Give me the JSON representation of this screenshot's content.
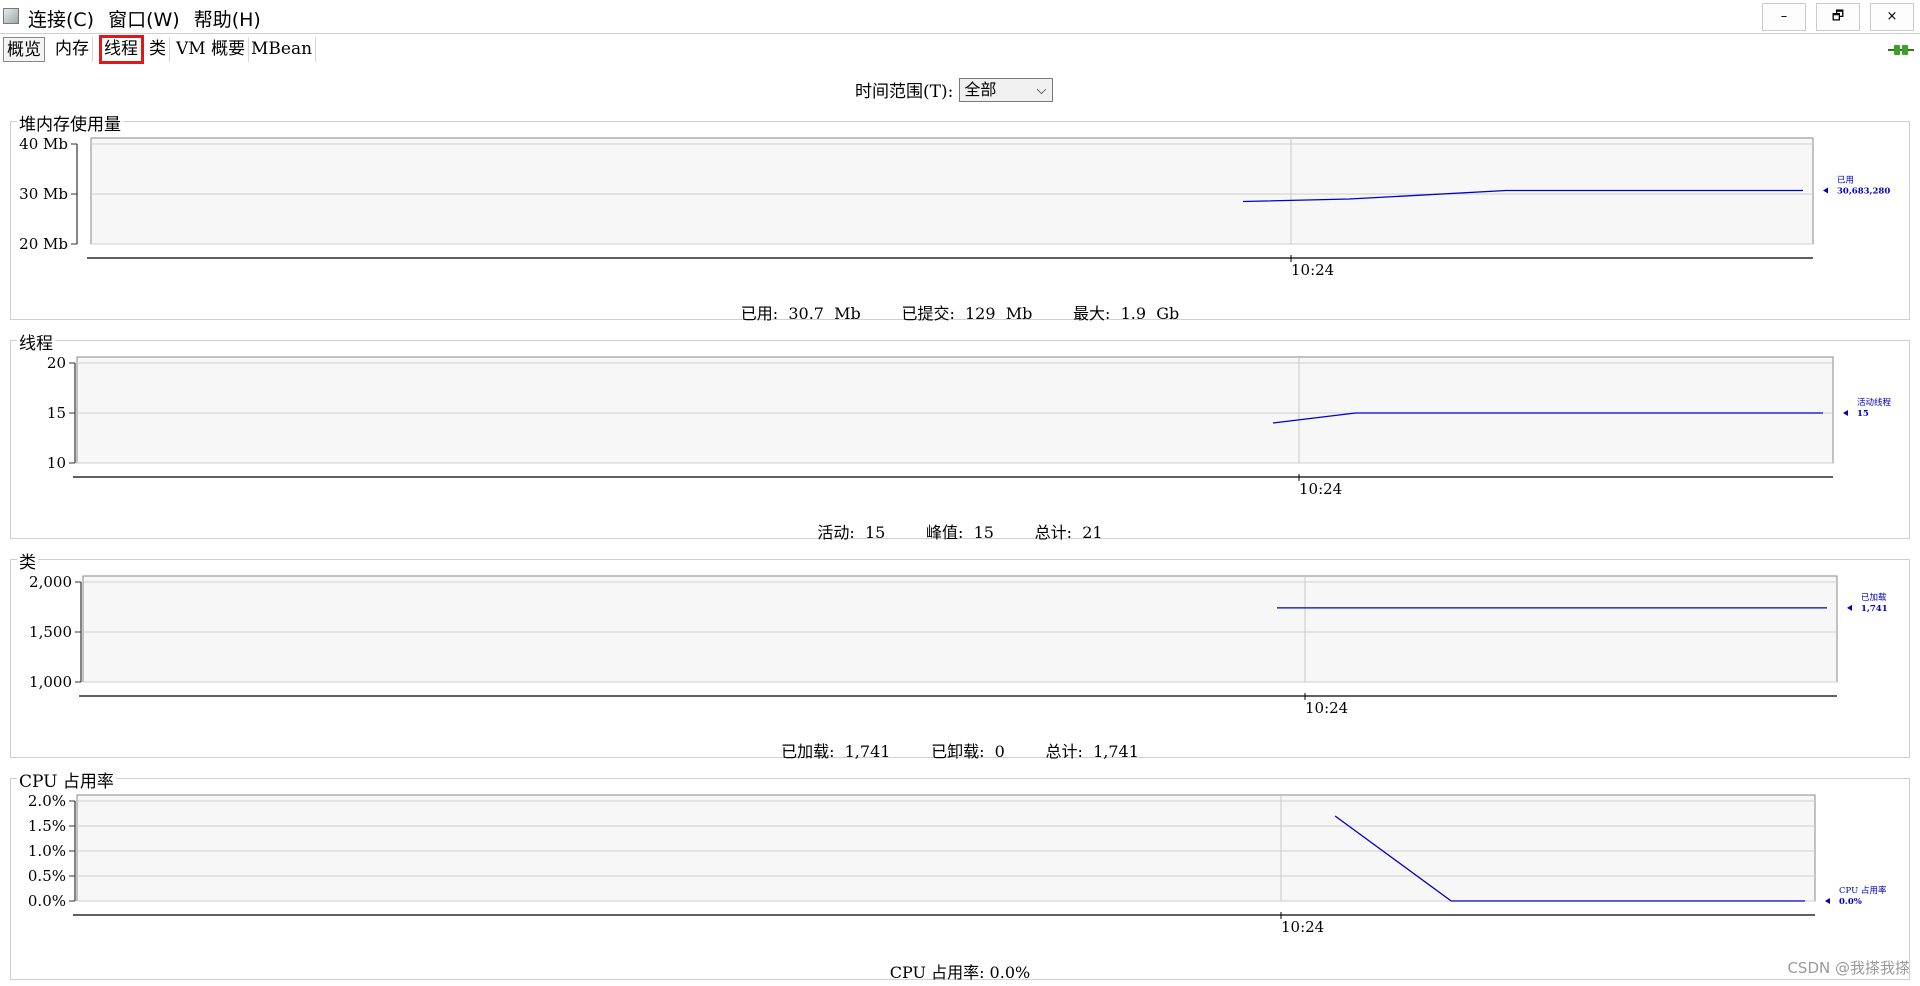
{
  "window": {
    "menu": [
      "连接(C)",
      "窗口(W)",
      "帮助(H)"
    ],
    "min_icon": "minimize-icon",
    "restore_icon": "restore-icon",
    "close_icon": "close-icon",
    "min_glyph": "–",
    "restore_glyph": "🗗",
    "close_glyph": "×"
  },
  "tabs": [
    {
      "label": "概览",
      "active": true
    },
    {
      "label": "内存",
      "active": false
    },
    {
      "label": "线程",
      "active": false,
      "highlighted": true
    },
    {
      "label": "类",
      "active": false
    },
    {
      "label": "VM 概要",
      "active": false
    },
    {
      "label": "MBean",
      "active": false
    }
  ],
  "time_range": {
    "label": "时间范围(T):",
    "value": "全部"
  },
  "colors": {
    "series": "#0000c8",
    "grid": "#cfcfcf",
    "plot_bg": "#f7f7f7",
    "highlight": "#e01818"
  },
  "panels": [
    {
      "title": "堆内存使用量",
      "summary": "已用:  30.7  Mb        已提交:  129  Mb        最大:  1.9  Gb",
      "legend_name": "已用",
      "legend_value": "30,683,280"
    },
    {
      "title": "线程",
      "summary": "活动:  15        峰值:  15        总计:  21",
      "legend_name": "活动线程",
      "legend_value": "15"
    },
    {
      "title": "类",
      "summary": "已加载:  1,741        已卸载:  0        总计:  1,741",
      "legend_name": "已加载",
      "legend_value": "1,741"
    },
    {
      "title": "CPU 占用率",
      "summary": "CPU 占用率: 0.0%",
      "legend_name": "CPU 占用率",
      "legend_value": "0.0%"
    }
  ],
  "chart_data": [
    {
      "type": "line",
      "series": [
        {
          "name": "已用",
          "x": [
            0.0,
            0.19,
            0.47,
            1.0
          ],
          "values": [
            28.5,
            29.0,
            30.7,
            30.7
          ]
        }
      ],
      "yticks": [
        "40 Mb",
        "30 Mb",
        "20 Mb"
      ],
      "ylim": [
        20,
        40
      ],
      "xtick": "10:24",
      "xtick_pos": 0.08
    },
    {
      "type": "line",
      "series": [
        {
          "name": "活动线程",
          "x": [
            0.0,
            0.15,
            1.0
          ],
          "values": [
            14,
            15,
            15
          ]
        }
      ],
      "yticks": [
        "20",
        "15",
        "10"
      ],
      "ylim": [
        10,
        20
      ],
      "xtick": "10:24",
      "xtick_pos": 0.04
    },
    {
      "type": "line",
      "series": [
        {
          "name": "已加载",
          "x": [
            0.0,
            1.0
          ],
          "values": [
            1741,
            1741
          ]
        }
      ],
      "yticks": [
        "2,000",
        "1,500",
        "1,000"
      ],
      "ylim": [
        1000,
        2000
      ],
      "xtick": "10:24",
      "xtick_pos": 0.04
    },
    {
      "type": "line",
      "series": [
        {
          "name": "CPU 占用率",
          "x": [
            0.11,
            0.33,
            1.0
          ],
          "values": [
            1.7,
            0.0,
            0.0
          ]
        }
      ],
      "yticks": [
        "2.0%",
        "1.5%",
        "1.0%",
        "0.5%",
        "0.0%"
      ],
      "ylim": [
        0,
        2
      ],
      "xtick": "10:24",
      "xtick_pos": 0.0
    }
  ],
  "watermark": "CSDN @我搽我搽"
}
